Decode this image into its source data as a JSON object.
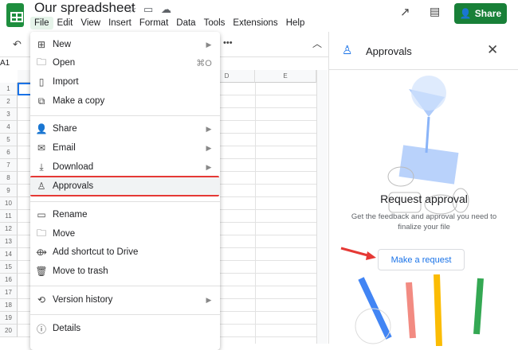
{
  "doc": {
    "title": "Our spreadsheet",
    "cell_ref": "A1"
  },
  "menubar": [
    "File",
    "Edit",
    "View",
    "Insert",
    "Format",
    "Data",
    "Tools",
    "Extensions",
    "Help"
  ],
  "share_label": "Share",
  "columns": [
    "D",
    "E"
  ],
  "rows": [
    "1",
    "2",
    "3",
    "4",
    "5",
    "6",
    "7",
    "8",
    "9",
    "10",
    "11",
    "12",
    "13",
    "14",
    "15",
    "16",
    "17",
    "18",
    "19",
    "20"
  ],
  "file_menu": {
    "new": "New",
    "open": "Open",
    "open_shortcut": "⌘O",
    "import": "Import",
    "copy": "Make a copy",
    "share": "Share",
    "email": "Email",
    "download": "Download",
    "approvals": "Approvals",
    "rename": "Rename",
    "move": "Move",
    "shortcut": "Add shortcut to Drive",
    "trash": "Move to trash",
    "version": "Version history",
    "details": "Details"
  },
  "panel": {
    "title": "Approvals",
    "heading": "Request approval",
    "desc1": "Get the feedback and approval you need to",
    "desc2": "finalize your file",
    "button": "Make a request"
  },
  "colors": {
    "accent": "#1a73e8",
    "share": "#188038",
    "highlight": "#e53935"
  }
}
